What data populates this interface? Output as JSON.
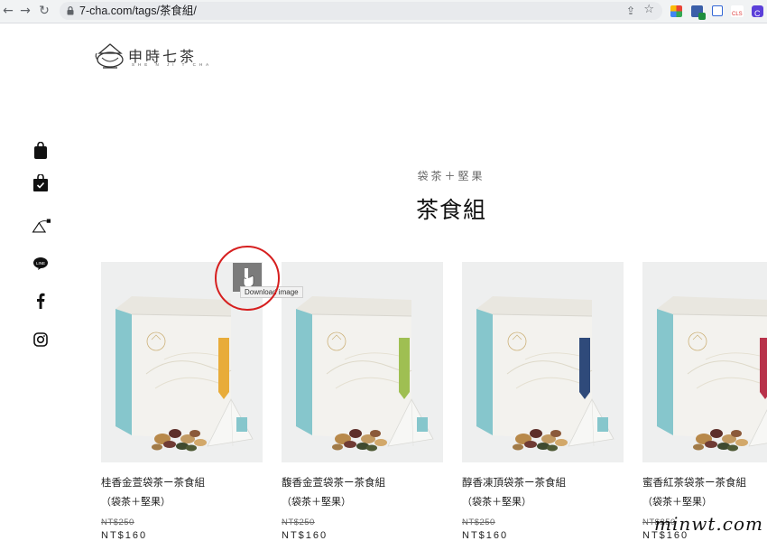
{
  "browser": {
    "url": "7-cha.com/tags/茶食組/"
  },
  "brand": {
    "name": "申時七茶",
    "romanized": "SHE  N  JI  T  CHA"
  },
  "page": {
    "subtitle": "袋茶＋堅果",
    "title": "茶食組"
  },
  "products": [
    {
      "name": "桂香金萱袋茶ー茶食組",
      "sub": "（袋茶＋堅果）",
      "orig_price": "NT$250",
      "price": "NT$160",
      "accent": "#e8ac3a"
    },
    {
      "name": "馥香金萱袋茶ー茶食組",
      "sub": "（袋茶＋堅果）",
      "orig_price": "NT$250",
      "price": "NT$160",
      "accent": "#9fbf52"
    },
    {
      "name": "醇香凍頂袋茶ー茶食組",
      "sub": "（袋茶＋堅果）",
      "orig_price": "NT$250",
      "price": "NT$160",
      "accent": "#2f4a7a"
    },
    {
      "name": "蜜香紅茶袋茶ー茶食組",
      "sub": "（袋茶＋堅果）",
      "orig_price": "NT$250",
      "price": "NT$160",
      "accent": "#b8324a"
    }
  ],
  "tooltip": {
    "text": "Download image"
  },
  "watermark": "minwt.com",
  "colors": {
    "box_teal": "#86c6cc",
    "highlight_circle": "#d61f1f"
  }
}
